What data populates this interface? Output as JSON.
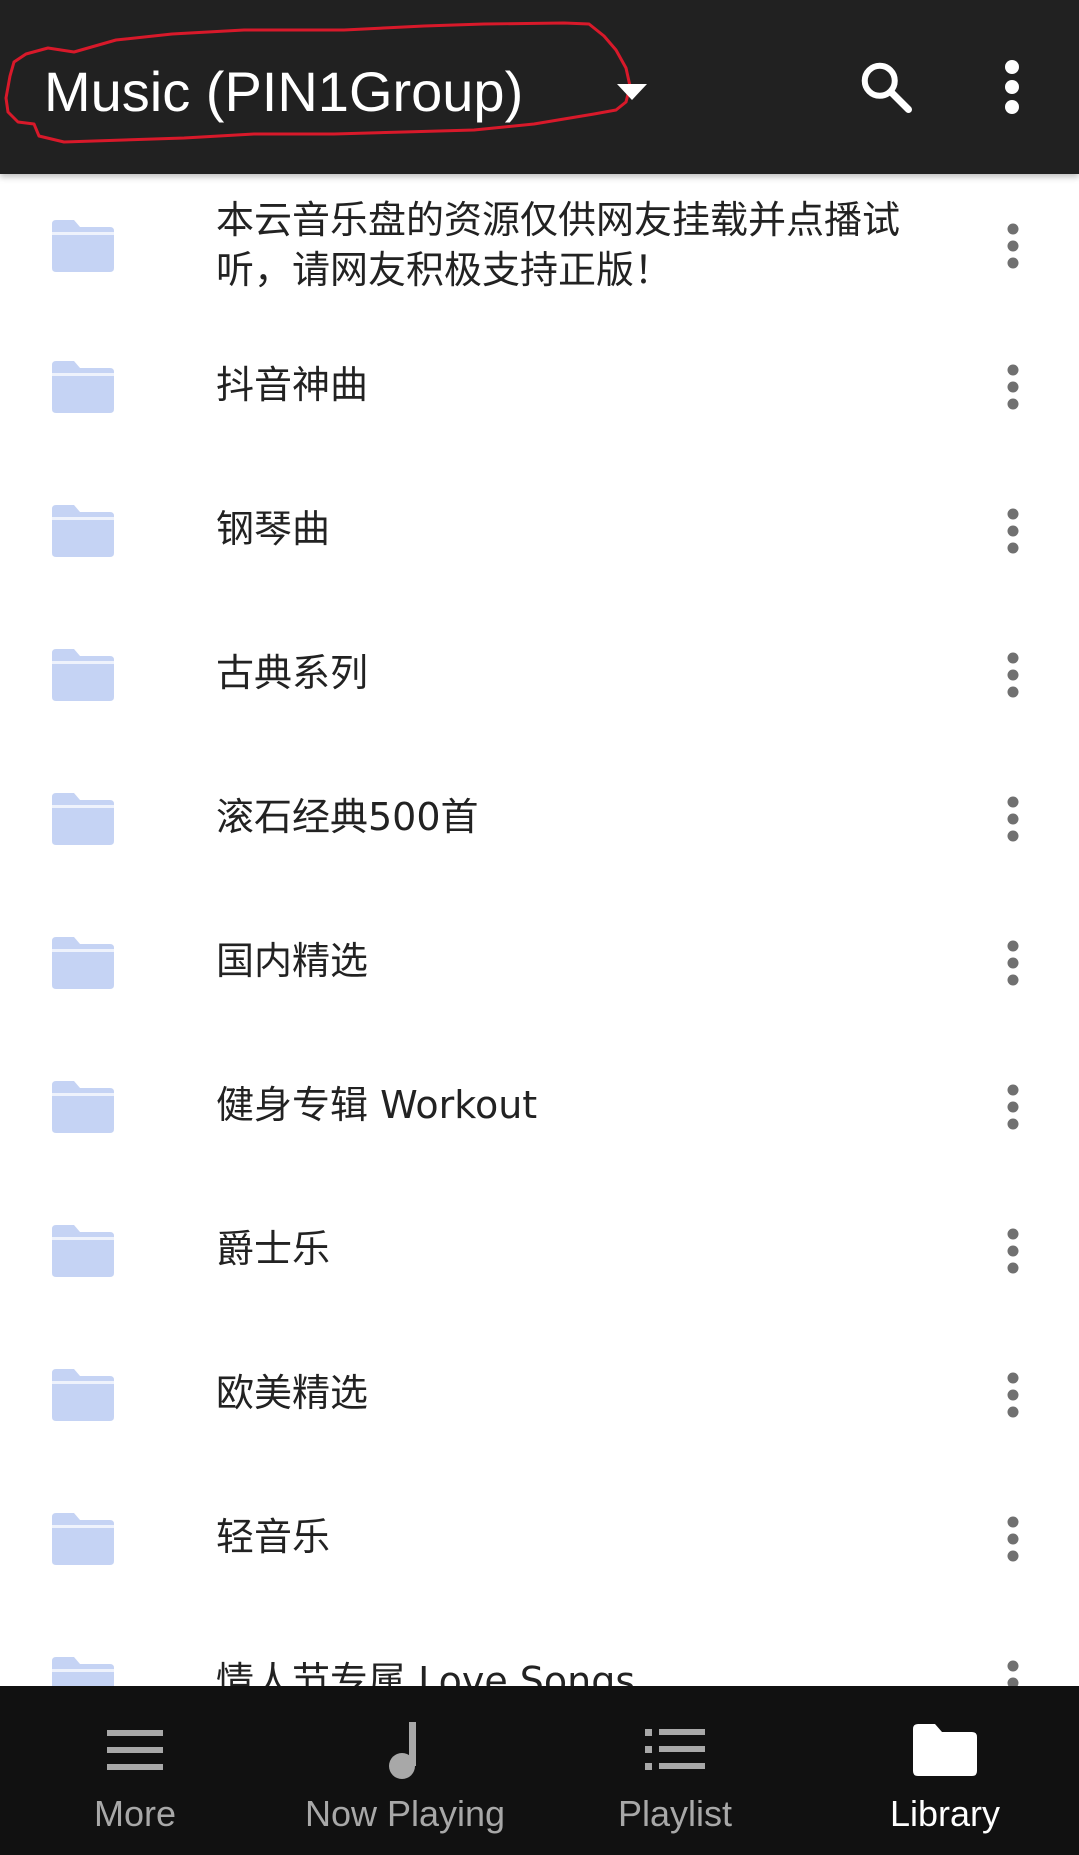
{
  "appbar": {
    "title": "Music (PIN1Group)",
    "icons": [
      "dropdown-arrow-icon",
      "search-icon",
      "more-vert-icon"
    ]
  },
  "folders": [
    {
      "label": "本云音乐盘的资源仅供网友挂载并点播试听，请网友积极支持正版！"
    },
    {
      "label": "抖音神曲"
    },
    {
      "label": "钢琴曲"
    },
    {
      "label": "古典系列"
    },
    {
      "label": "滚石经典500首"
    },
    {
      "label": "国内精选"
    },
    {
      "label": "健身专辑 Workout"
    },
    {
      "label": "爵士乐"
    },
    {
      "label": "欧美精选"
    },
    {
      "label": "轻音乐"
    },
    {
      "label": "情人节专属 Love Songs"
    }
  ],
  "bottom_nav": {
    "items": [
      {
        "label": "More",
        "icon": "menu-icon"
      },
      {
        "label": "Now Playing",
        "icon": "music-note-icon"
      },
      {
        "label": "Playlist",
        "icon": "playlist-icon"
      },
      {
        "label": "Library",
        "icon": "folder-icon"
      }
    ],
    "active": "Library"
  },
  "colors": {
    "appbar_bg": "#212121",
    "bottomnav_bg": "#111111",
    "folder_icon": "#c5d3f4",
    "title_outline": "#d8192a",
    "nav_label_inactive": "#a8a8a8",
    "nav_label_active": "#ffffff"
  }
}
